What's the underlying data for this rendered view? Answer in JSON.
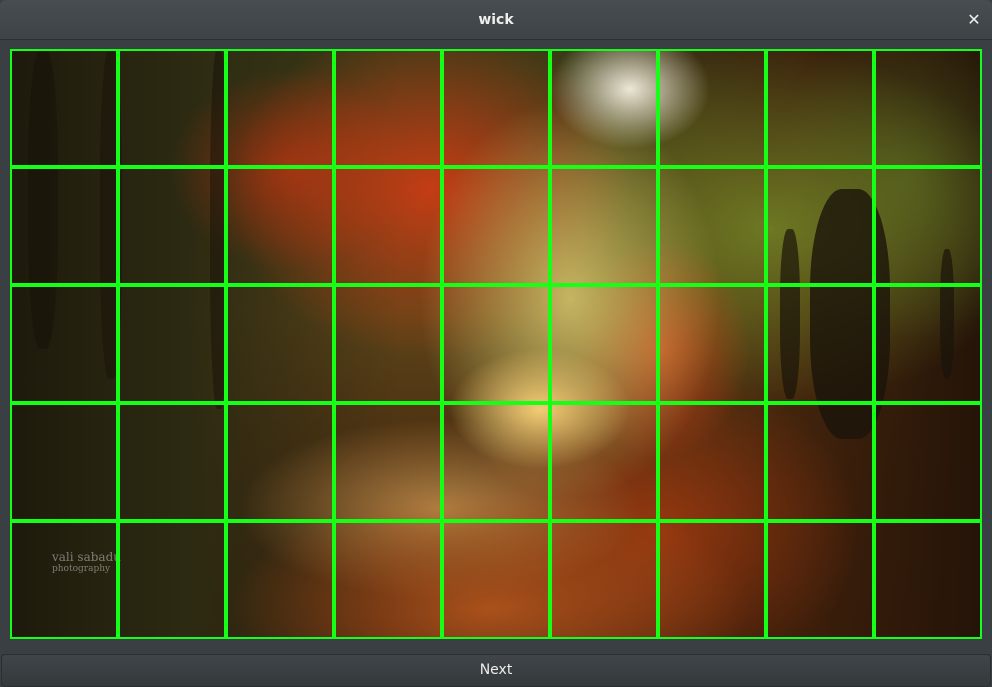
{
  "window": {
    "title": "wick",
    "close_glyph": "✕"
  },
  "captcha": {
    "rows": 5,
    "columns": 9,
    "grid_color": "#16ff16",
    "image_description_icon": "autumn-forest-path-photo",
    "watermark": {
      "line1": "vali sabadu",
      "line2": "photography"
    }
  },
  "footer": {
    "next_label": "Next"
  }
}
